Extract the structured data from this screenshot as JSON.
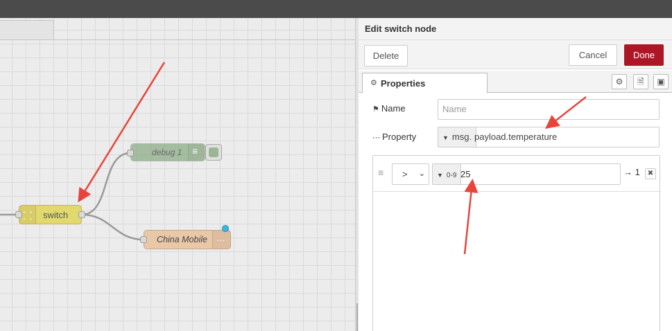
{
  "workspace": {
    "nodes": {
      "switch_label": "switch",
      "debug_label": "debug 1",
      "china_mobile_label": "China Mobile"
    }
  },
  "panel": {
    "title": "Edit switch node",
    "buttons": {
      "delete": "Delete",
      "cancel": "Cancel",
      "done": "Done"
    },
    "tabs": {
      "properties": "Properties"
    },
    "fields": {
      "name_label": "Name",
      "name_placeholder": "Name",
      "property_label": "Property",
      "property_type": "msg.",
      "property_value": "payload.temperature"
    },
    "rules": [
      {
        "operator": ">",
        "value_type_icon": "0-9",
        "value": "25",
        "output_label": "→ 1",
        "remove_icon": "✖"
      }
    ]
  },
  "colors": {
    "done_button": "#ad1625",
    "switch_node": "#e2d96e",
    "debug_node": "#87a980",
    "china_mobile_node": "#e9c8a8",
    "annotation_arrow": "#e8443a"
  }
}
